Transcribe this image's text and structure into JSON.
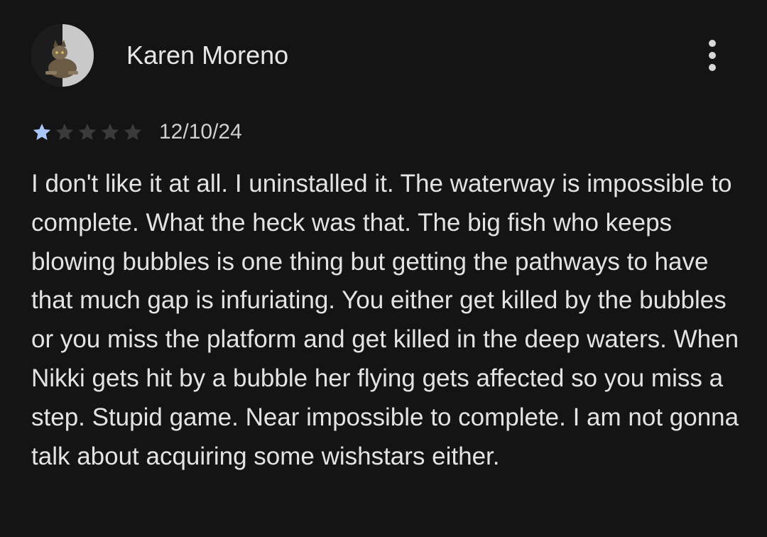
{
  "review": {
    "author_name": "Karen Moreno",
    "rating": 1,
    "max_rating": 5,
    "date": "12/10/24",
    "text": "I don't like it at all. I uninstalled it. The waterway is impossible to complete. What the heck was that. The big fish who keeps blowing bubbles is one thing but getting the pathways to have that much gap is infuriating. You either get killed by the bubbles or you miss the platform and get killed in the deep waters. When Nikki gets hit by a bubble her flying gets affected so you miss a step. Stupid game. Near impossible to complete. I am not gonna talk about acquiring some wishstars either."
  },
  "icons": {
    "avatar": "cat-photo-avatar",
    "menu": "more-vert-icon",
    "star": "star-icon"
  },
  "colors": {
    "background": "#141414",
    "text": "#e3e3e3",
    "star_filled": "#a8c7fa",
    "star_empty": "#3a3a3a"
  }
}
